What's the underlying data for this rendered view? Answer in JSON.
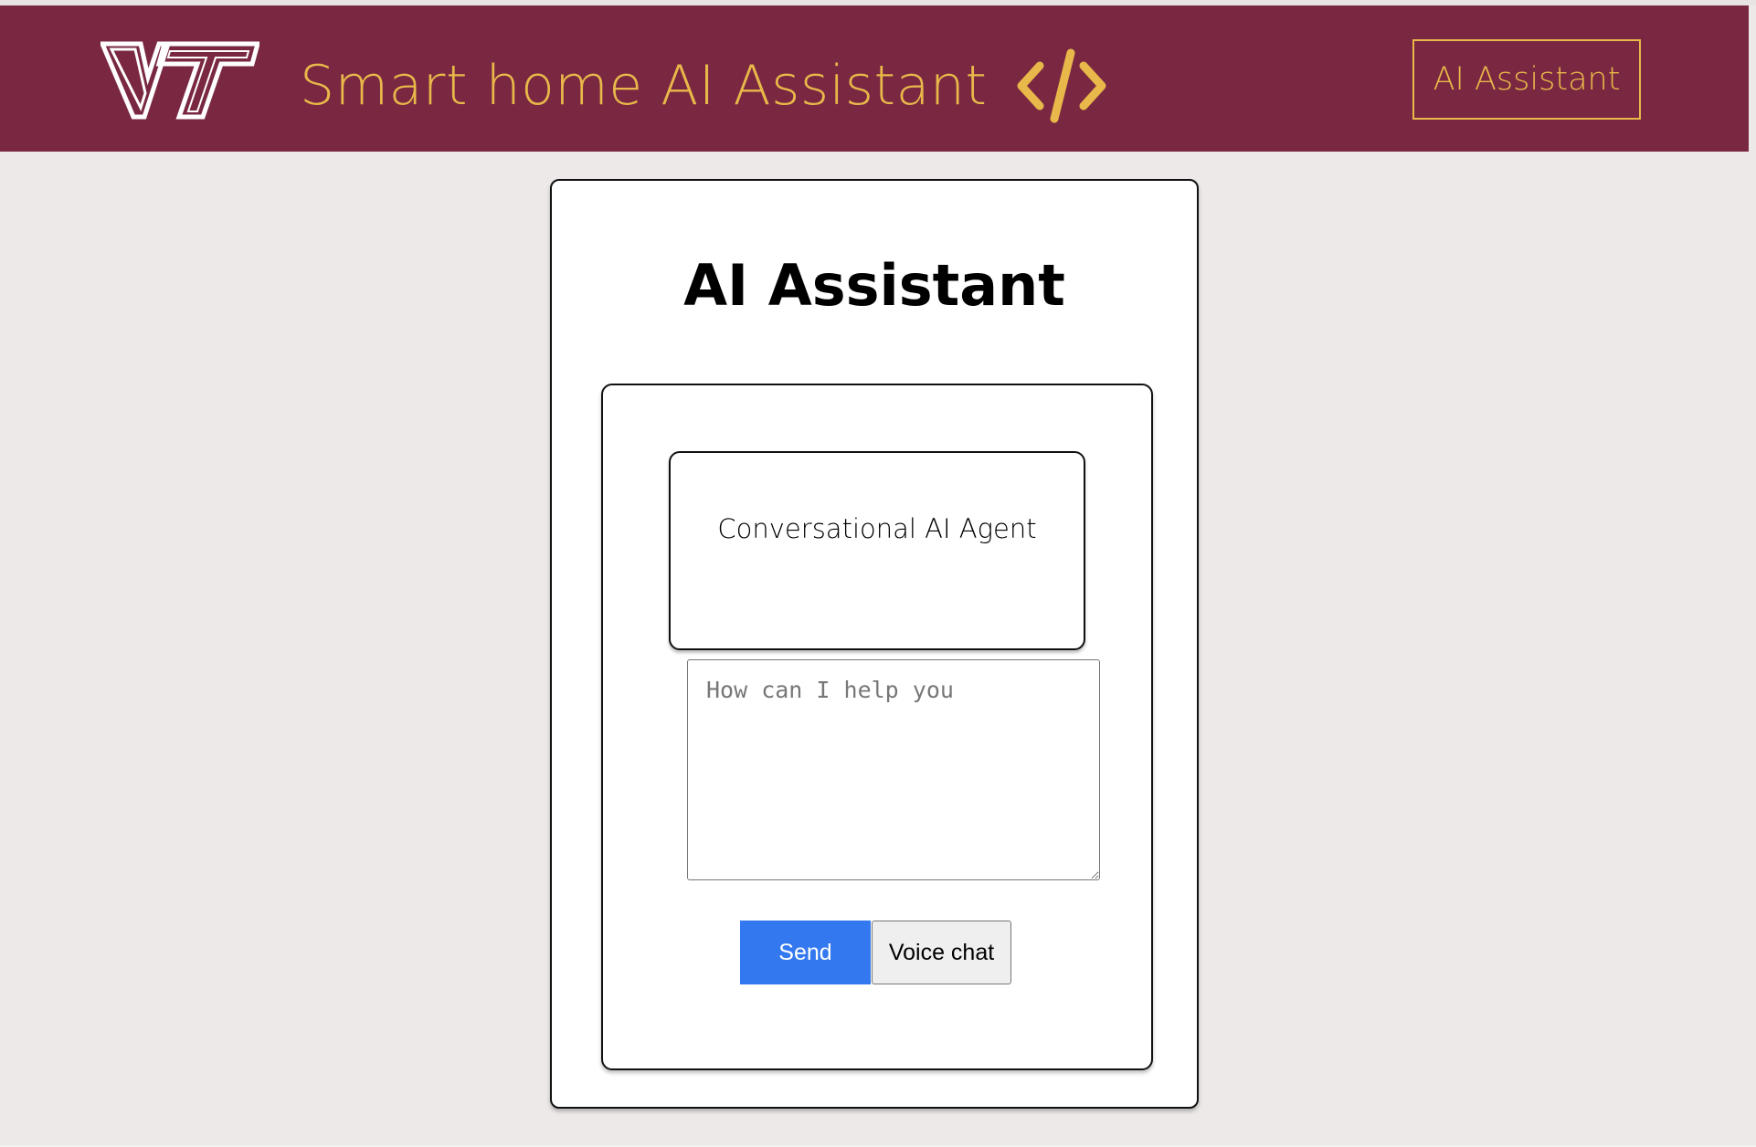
{
  "header": {
    "logo_icon": "vt-logo-icon",
    "title": "Smart home AI Assistant",
    "title_icon": "code-brackets-icon",
    "nav_button_label": "AI Assistant"
  },
  "card": {
    "title": "AI Assistant",
    "agent_label": "Conversational AI Agent",
    "input": {
      "value": "",
      "placeholder": "How can I help you"
    },
    "send_label": "Send",
    "voice_label": "Voice chat"
  },
  "colors": {
    "header_bg": "#7a2841",
    "accent_gold": "#e9b84a",
    "page_bg": "#ece9e8",
    "send_blue": "#3478f0"
  }
}
